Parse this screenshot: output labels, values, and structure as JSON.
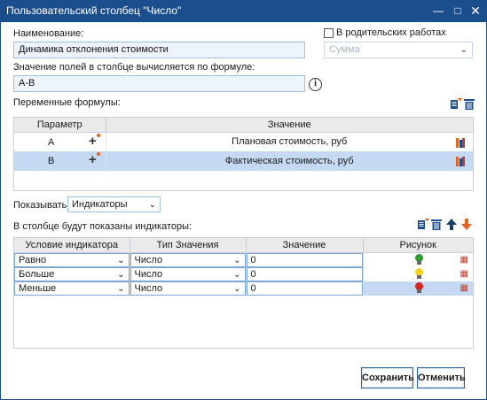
{
  "window": {
    "title": "Пользовательский столбец \"Число\""
  },
  "name": {
    "label": "Наименование:",
    "value": "Динамика отклонения стоимости"
  },
  "parent_works": {
    "label": "В родительских работах",
    "checked": false,
    "aggregate": "Сумма"
  },
  "formula": {
    "label": "Значение полей в столбце вычисляется по формуле:",
    "value": "А-В",
    "info": "i"
  },
  "variables": {
    "label": "Переменные формулы:",
    "columns": [
      "Параметр",
      "Значение"
    ],
    "rows": [
      {
        "param": "А",
        "value": "Плановая стоимость, руб"
      },
      {
        "param": "В",
        "value": "Фактическая стоимость, руб"
      }
    ]
  },
  "show": {
    "label": "Показывать:",
    "value": "Индикаторы"
  },
  "indicators": {
    "label": "В столбце будут показаны индикаторы:",
    "columns": [
      "Условие индикатора",
      "Тип Значения",
      "Значение",
      "Рисунок"
    ],
    "rows": [
      {
        "condition": "Равно",
        "type": "Число",
        "value": "0",
        "bulb_color": "#2e9a2e"
      },
      {
        "condition": "Больше",
        "type": "Число",
        "value": "0",
        "bulb_color": "#f2d21c"
      },
      {
        "condition": "Меньше",
        "type": "Число",
        "value": "0",
        "bulb_color": "#d9261c"
      }
    ]
  },
  "buttons": {
    "save": "Сохранить",
    "cancel": "Отменить"
  },
  "colors": {
    "titlebar": "#1b4e8c",
    "selected_row": "#c5daf2",
    "accent_orange": "#e8631b"
  }
}
